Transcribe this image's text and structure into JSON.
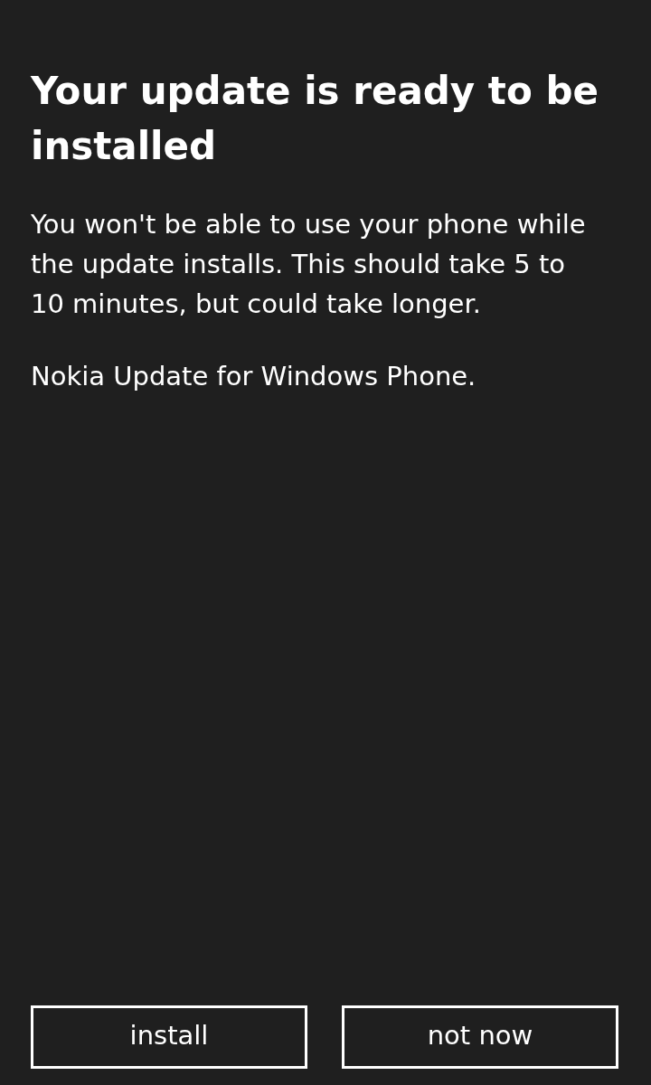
{
  "dialog": {
    "title": "Your update is ready to be installed",
    "paragraphs": [
      "You won't be able to use your phone while the update installs. This should take 5 to 10 minutes, but could take longer.",
      "Nokia Update for Windows Phone."
    ],
    "buttons": [
      "install",
      "not now"
    ]
  }
}
